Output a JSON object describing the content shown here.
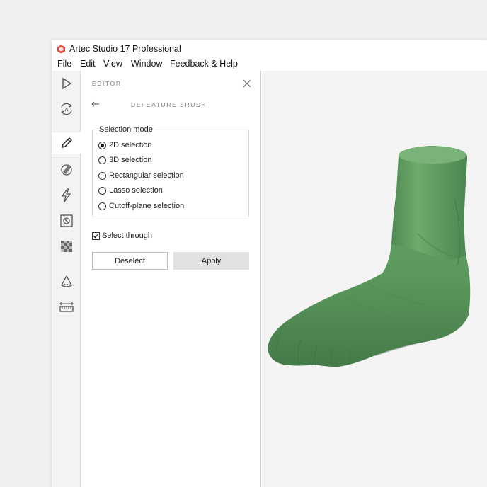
{
  "window": {
    "title": "Artec Studio 17 Professional"
  },
  "menu": [
    "File",
    "Edit",
    "View",
    "Window",
    "Feedback & Help"
  ],
  "toolbar": {
    "items": [
      "play-icon",
      "autopilot-icon",
      "pencil-icon",
      "eraser-brush-icon",
      "lightning-icon",
      "target-icon",
      "checker-texture-icon",
      "cone-measure-icon",
      "ruler-icon"
    ],
    "active": "pencil-icon"
  },
  "panel": {
    "header": "EDITOR",
    "subheader": "DEFEATURE BRUSH",
    "selection_mode": {
      "legend": "Selection mode",
      "options": [
        "2D selection",
        "3D selection",
        "Rectangular selection",
        "Lasso selection",
        "Cutoff-plane selection"
      ],
      "selected": "2D selection"
    },
    "select_through": {
      "label": "Select through",
      "checked": true
    },
    "buttons": {
      "deselect": "Deselect",
      "apply": "Apply"
    }
  },
  "colors": {
    "model": "#5e9a5f",
    "accent": "#e8453c"
  }
}
